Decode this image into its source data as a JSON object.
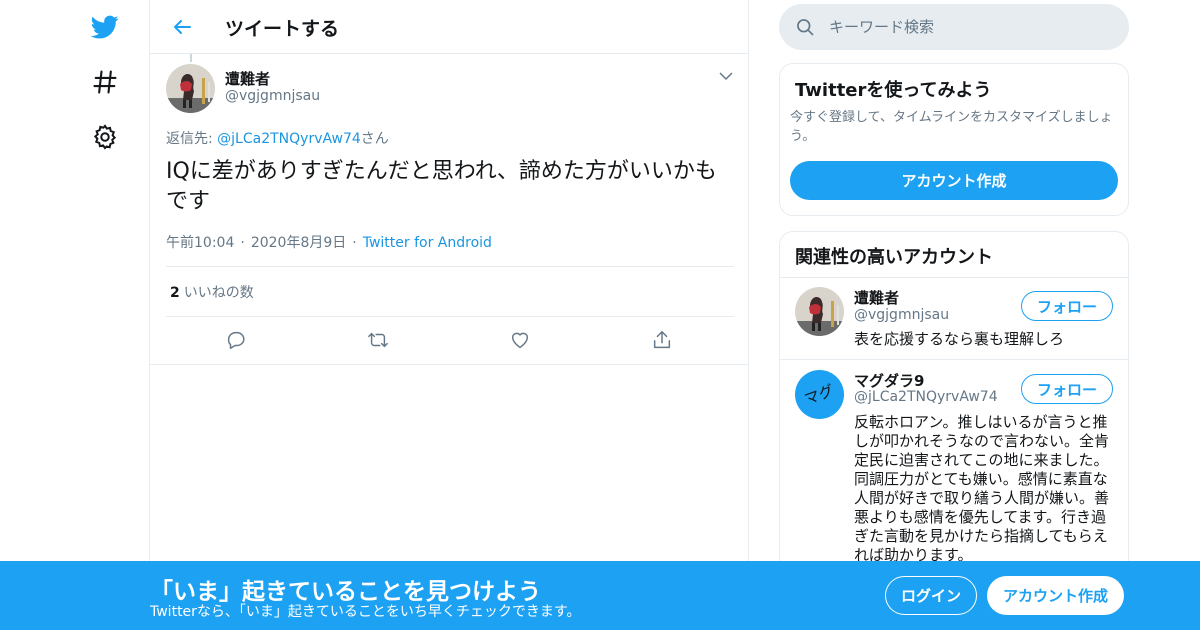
{
  "colors": {
    "accent": "#1da1f2",
    "link": "#1b95e0",
    "muted": "#657786",
    "border": "#e6ecf0",
    "text": "#14171a"
  },
  "nav": {
    "items": [
      {
        "icon": "twitter-bird-icon"
      },
      {
        "icon": "hashtag-icon"
      },
      {
        "icon": "gear-icon"
      }
    ]
  },
  "header": {
    "title": "ツイートする"
  },
  "tweet": {
    "author_name": "遭難者",
    "author_handle": "@vgjgmnjsau",
    "reply_prefix": "返信先: ",
    "reply_target": "@jLCa2TNQyrvAw74",
    "reply_suffix": "さん",
    "text": "IQに差がありすぎたんだと思われ、諦めた方がいいかもです",
    "time": "午前10:04",
    "date": "2020年8月9日",
    "source": "Twitter for Android",
    "likes_count": "2",
    "likes_label": "いいねの数",
    "actions": [
      "reply-icon",
      "retweet-icon",
      "like-icon",
      "share-icon"
    ]
  },
  "search": {
    "placeholder": "キーワード検索"
  },
  "signup_card": {
    "title": "Twitterを使ってみよう",
    "text": "今すぐ登録して、タイムラインをカスタマイズしましょう。",
    "button": "アカウント作成"
  },
  "related": {
    "title": "関連性の高いアカウント",
    "accounts": [
      {
        "name": "遭難者",
        "handle": "@vgjgmnjsau",
        "bio": "表を応援するなら裏も理解しろ",
        "follow": "フォロー"
      },
      {
        "name": "マグダラ9",
        "handle": "@jLCa2TNQyrvAw74",
        "avatar_text": "マグ",
        "bio": "反転ホロアン。推しはいるが言うと推しが叩かれそうなので言わない。全肯定民に迫害されてこの地に来ました。同調圧力がとても嫌い。感情に素直な人間が好きで取り繕う人間が嫌い。善悪よりも感情を優先してます。行き過ぎた言動を見かけたら指摘してもらえれば助かります。",
        "follow": "フォロー"
      }
    ]
  },
  "banner": {
    "title": "「いま」起きていることを見つけよう",
    "subtitle": "Twitterなら、「いま」起きていることをいち早くチェックできます。",
    "login": "ログイン",
    "signup": "アカウント作成"
  }
}
